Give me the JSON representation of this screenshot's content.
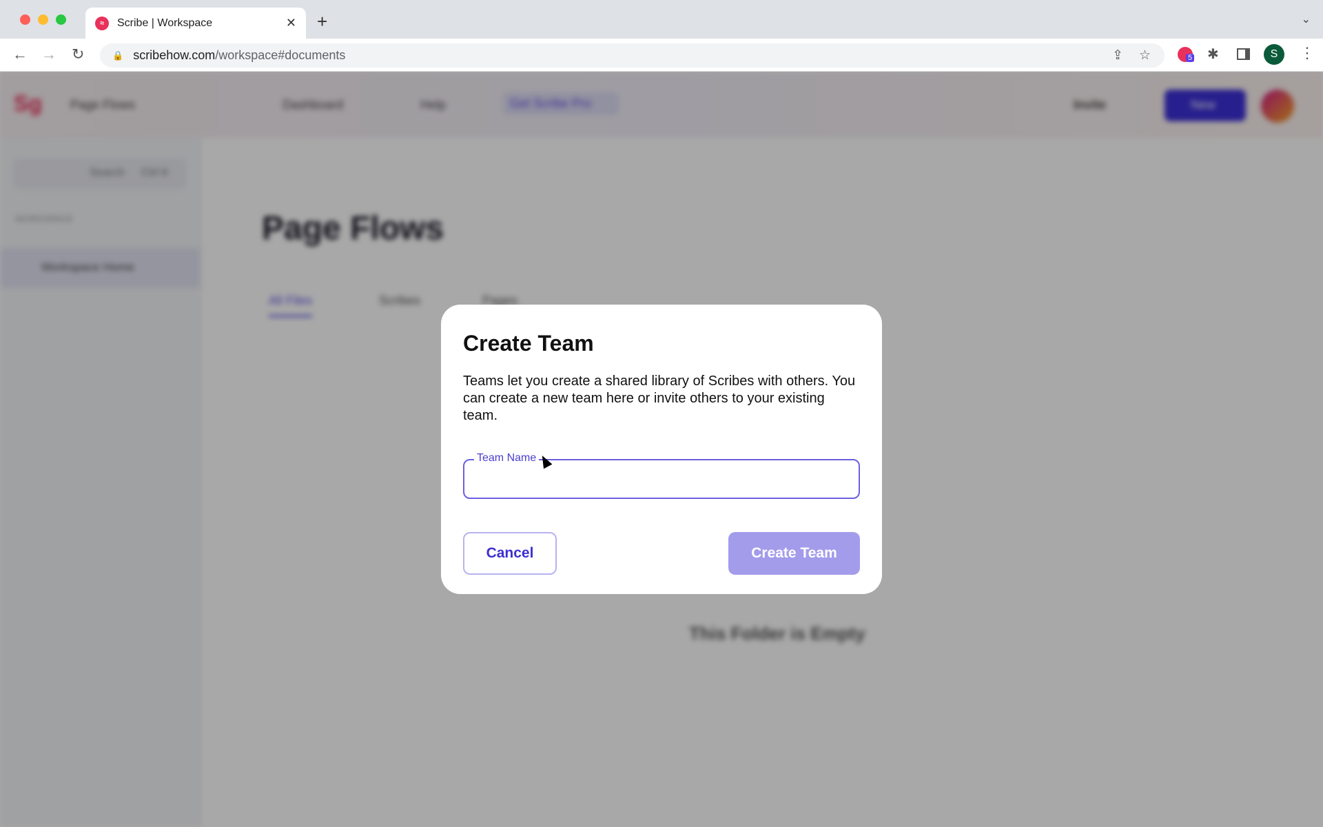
{
  "browser": {
    "tab_title": "Scribe | Workspace",
    "url_host": "scribehow.com",
    "url_path": "/workspace#documents",
    "extension_badge": "5",
    "profile_initial": "S",
    "icons": [
      "back-arrow-icon",
      "forward-arrow-icon",
      "reload-icon",
      "lock-icon",
      "share-icon",
      "star-icon",
      "scribe-extension-icon",
      "puzzle-icon",
      "sidebar-icon",
      "kebab-menu-icon"
    ]
  },
  "app_background": {
    "workspace_dropdown": "Page Flows",
    "nav": [
      "Dashboard",
      "Help",
      "Get Scribe Pro"
    ],
    "invite": "Invite",
    "new_button": "New",
    "search": "Search",
    "search_shortcut": "Ctrl K",
    "sidebar_section": "WORKSPACE",
    "sidebar_item": "Workspace Home",
    "page_title": "Page Flows",
    "tabs": [
      "All Files",
      "Scribes",
      "Pages"
    ],
    "empty_text": "This Folder is Empty"
  },
  "dialog": {
    "title": "Create Team",
    "description": "Teams let you create a shared library of Scribes with others. You can create a new team here or invite others to your existing team.",
    "field_label": "Team Name",
    "field_value": "",
    "cancel_label": "Cancel",
    "create_label": "Create Team"
  },
  "colors": {
    "accent": "#4a3fcf",
    "create_disabled": "#a39ceb",
    "scribe_brand": "#e8315b"
  }
}
